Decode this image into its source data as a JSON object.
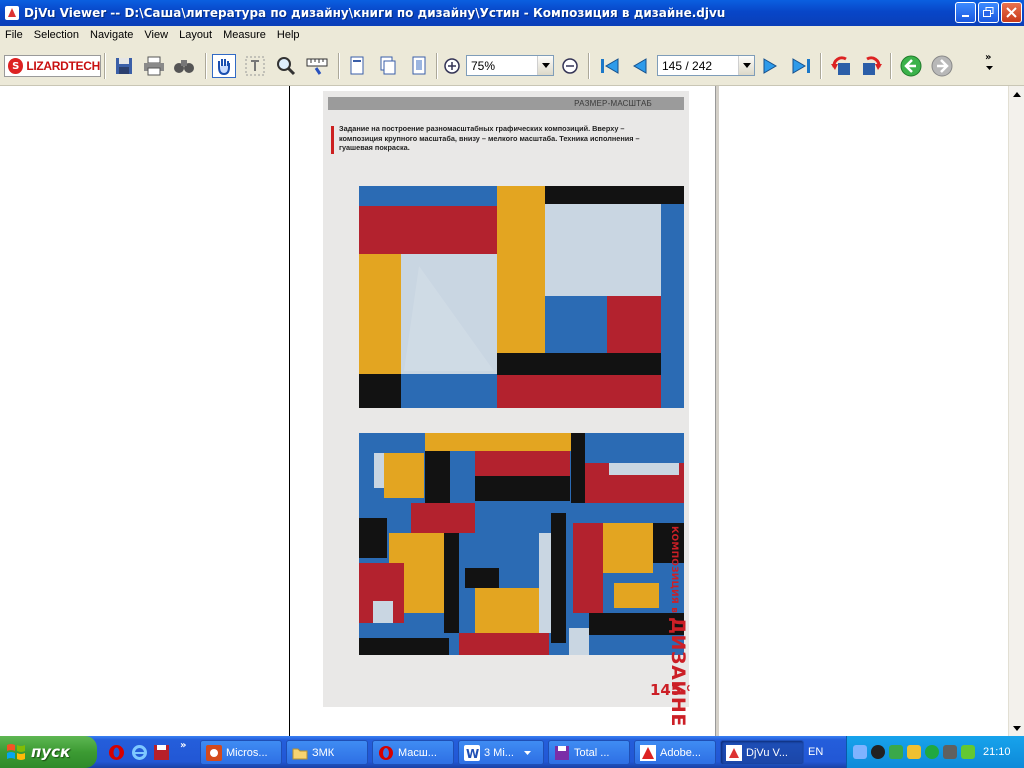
{
  "window": {
    "title": "DjVu Viewer -- D:\\Саша\\литература по дизайну\\книги по дизайну\\Устин - Композиция в дизайне.djvu"
  },
  "menu": [
    "File",
    "Selection",
    "Navigate",
    "View",
    "Layout",
    "Measure",
    "Help"
  ],
  "toolbar": {
    "logo_text": "LIZARDTECH",
    "zoom_value": "75%",
    "page_value": "145 / 242",
    "overflow_label": "»"
  },
  "document": {
    "header_label": "РАЗМЕР-МАСШТАБ",
    "caption": "Задание на построение разномасштабных графических композиций. Вверху – композиция крупного масштаба, внизу – мелкого масштаба. Техника исполнения – гуашевая покраска.",
    "side_title_small": "КОМПОЗИЦИЯ в",
    "side_title_big": "ДИЗАЙНЕ",
    "page_number": "145",
    "colors": {
      "red": "#b3222e",
      "blue": "#2b6bb4",
      "yellow": "#e3a521",
      "black": "#121212",
      "light": "#c9d6e2",
      "accent": "#cc1f26"
    }
  },
  "taskbar": {
    "start_label": "пуск",
    "tasks": [
      {
        "label": "Micros..."
      },
      {
        "label": "ЗМК"
      },
      {
        "label": "Масш..."
      },
      {
        "label": "3 Mi..."
      },
      {
        "label": "Total ..."
      },
      {
        "label": "Adobe..."
      },
      {
        "label": "DjVu V..."
      }
    ],
    "language": "EN",
    "clock": "21:10"
  }
}
